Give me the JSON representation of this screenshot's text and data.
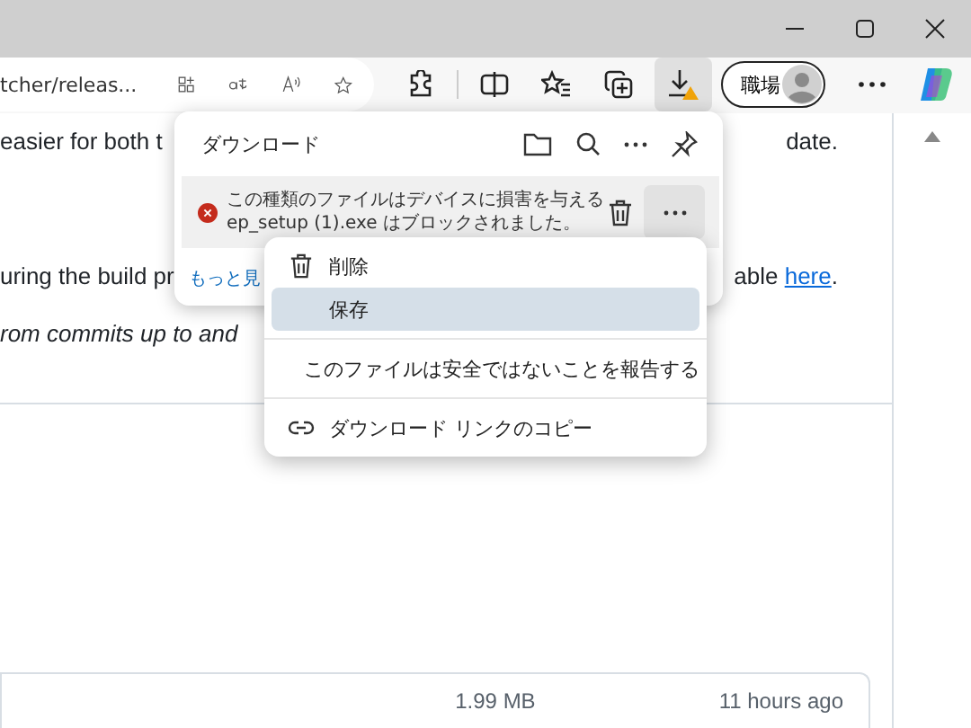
{
  "address_bar": {
    "url": "tcher/releas..."
  },
  "toolbar": {
    "downloads_selected": true,
    "download_warning": true,
    "profile_label": "職場"
  },
  "page": {
    "lines": [
      {
        "left": "easier for both t",
        "right": "date.",
        "italic": false
      },
      {
        "left": "uring the build pr",
        "right": "able ",
        "link": "here",
        "after": ".",
        "italic": false
      },
      {
        "left": "rom commits up to and",
        "italic": true
      }
    ],
    "asset": {
      "size": "1.99 MB",
      "time": "11 hours ago"
    }
  },
  "downloads_panel": {
    "title": "ダウンロード",
    "item": {
      "blocked": true,
      "message": "この種類のファイルはデバイスに損害を与える",
      "filename_line": "ep_setup (1).exe はブロックされました。"
    },
    "more_link": "もっと見"
  },
  "context_menu": [
    {
      "kind": "trash",
      "label": "削除",
      "selected": false
    },
    {
      "kind": "none",
      "label": "保存",
      "selected": true
    },
    {
      "kind": "separator"
    },
    {
      "kind": "none",
      "label": "このファイルは安全ではないことを報告する",
      "selected": false
    },
    {
      "kind": "separator"
    },
    {
      "kind": "link",
      "label": "ダウンロード リンクのコピー",
      "selected": false
    }
  ]
}
